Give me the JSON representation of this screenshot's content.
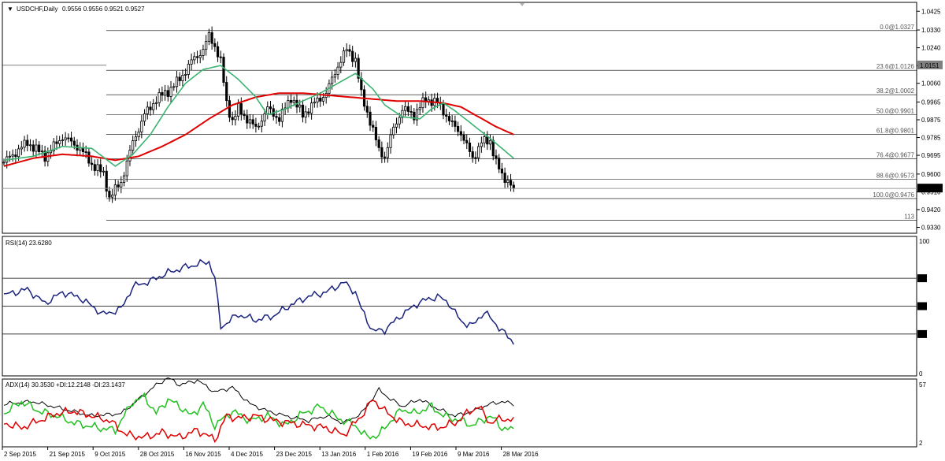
{
  "header": {
    "symbol_title": "USDCHF,Daily",
    "ohlc": "0.9556 0.9556 0.9521 0.9527",
    "dropdown_glyph": "▼"
  },
  "colors": {
    "candle": "#000000",
    "ma_fast": "#3cb371",
    "ma_slow": "#e00000",
    "rsi": "#1a237e",
    "adx": "#000000",
    "plus_di": "#22c020",
    "minus_di": "#e00000",
    "fib": "#000000"
  },
  "chart_data": [
    {
      "type": "candlestick",
      "title": "USDCHF,Daily",
      "ylim": [
        0.93,
        1.047
      ],
      "price_ticks": [
        "1.0425",
        "1.0330",
        "1.0240",
        "1.0150",
        "1.0060",
        "0.9965",
        "0.9875",
        "0.9785",
        "0.9695",
        "0.9600",
        "0.9510",
        "0.9420",
        "0.9330"
      ],
      "price_tick_values": [
        1.0425,
        1.033,
        1.024,
        1.015,
        1.006,
        0.9965,
        0.9875,
        0.9785,
        0.9695,
        0.96,
        0.951,
        0.942,
        0.933
      ],
      "current_price_label": "0.9527",
      "current_price": 0.9527,
      "fib_price_label": "1.0151",
      "fib_price": 1.0151,
      "x_labels": [
        "2 Sep 2015",
        "21 Sep 2015",
        "9 Oct 2015",
        "28 Oct 2015",
        "16 Nov 2015",
        "4 Dec 2015",
        "23 Dec 2015",
        "13 Jan 2016",
        "1 Feb 2016",
        "19 Feb 2016",
        "9 Mar 2016",
        "28 Mar 2016"
      ],
      "fib_levels": [
        {
          "label": "0.0@1.0327",
          "price": 1.0327
        },
        {
          "label": "23.6@1.0126",
          "price": 1.0126
        },
        {
          "label": "38.2@1.0002",
          "price": 1.0002
        },
        {
          "label": "50.0@0.9901",
          "price": 0.9901
        },
        {
          "label": "61.8@0.9801",
          "price": 0.9801
        },
        {
          "label": "76.4@0.9677",
          "price": 0.9677
        },
        {
          "label": "88.6@0.9573",
          "price": 0.9573
        },
        {
          "label": "100.0@0.9476",
          "price": 0.9476
        },
        {
          "label": "113",
          "price": 0.9366
        }
      ],
      "close_keypoints": [
        [
          0,
          0.966
        ],
        [
          8,
          0.976
        ],
        [
          14,
          0.969
        ],
        [
          20,
          0.979
        ],
        [
          26,
          0.973
        ],
        [
          30,
          0.965
        ],
        [
          34,
          0.96
        ],
        [
          36,
          0.948
        ],
        [
          40,
          0.956
        ],
        [
          44,
          0.976
        ],
        [
          48,
          0.99
        ],
        [
          52,
          0.998
        ],
        [
          56,
          1.002
        ],
        [
          60,
          1.008
        ],
        [
          64,
          1.017
        ],
        [
          68,
          1.023
        ],
        [
          70,
          1.03
        ],
        [
          72,
          1.025
        ],
        [
          74,
          1.017
        ],
        [
          76,
          0.996
        ],
        [
          78,
          0.987
        ],
        [
          80,
          0.993
        ],
        [
          83,
          0.988
        ],
        [
          86,
          0.983
        ],
        [
          90,
          0.993
        ],
        [
          94,
          0.988
        ],
        [
          98,
          0.999
        ],
        [
          102,
          0.99
        ],
        [
          106,
          0.996
        ],
        [
          110,
          1.001
        ],
        [
          114,
          1.015
        ],
        [
          117,
          1.023
        ],
        [
          120,
          1.018
        ],
        [
          122,
          1.0
        ],
        [
          125,
          0.987
        ],
        [
          128,
          0.972
        ],
        [
          130,
          0.969
        ],
        [
          133,
          0.983
        ],
        [
          136,
          0.993
        ],
        [
          140,
          0.99
        ],
        [
          144,
          0.998
        ],
        [
          148,
          0.996
        ],
        [
          150,
          0.992
        ],
        [
          153,
          0.985
        ],
        [
          156,
          0.981
        ],
        [
          158,
          0.974
        ],
        [
          160,
          0.968
        ],
        [
          163,
          0.976
        ],
        [
          166,
          0.977
        ],
        [
          168,
          0.966
        ],
        [
          170,
          0.959
        ],
        [
          172,
          0.957
        ],
        [
          174,
          0.9527
        ]
      ],
      "ma_fast_keypoints": [
        [
          0,
          0.967
        ],
        [
          10,
          0.969
        ],
        [
          20,
          0.974
        ],
        [
          30,
          0.973
        ],
        [
          38,
          0.964
        ],
        [
          44,
          0.97
        ],
        [
          50,
          0.98
        ],
        [
          56,
          0.994
        ],
        [
          62,
          1.006
        ],
        [
          68,
          1.013
        ],
        [
          74,
          1.015
        ],
        [
          80,
          1.008
        ],
        [
          86,
          0.999
        ],
        [
          90,
          0.99
        ],
        [
          96,
          0.993
        ],
        [
          102,
          0.997
        ],
        [
          108,
          1.001
        ],
        [
          114,
          1.006
        ],
        [
          120,
          1.011
        ],
        [
          126,
          1.003
        ],
        [
          130,
          0.995
        ],
        [
          136,
          0.989
        ],
        [
          142,
          0.988
        ],
        [
          146,
          0.993
        ],
        [
          150,
          0.996
        ],
        [
          154,
          0.992
        ],
        [
          160,
          0.985
        ],
        [
          166,
          0.978
        ],
        [
          170,
          0.973
        ],
        [
          174,
          0.968
        ]
      ],
      "ma_slow_keypoints": [
        [
          0,
          0.964
        ],
        [
          10,
          0.968
        ],
        [
          20,
          0.97
        ],
        [
          30,
          0.969
        ],
        [
          38,
          0.967
        ],
        [
          46,
          0.969
        ],
        [
          54,
          0.974
        ],
        [
          62,
          0.98
        ],
        [
          70,
          0.988
        ],
        [
          78,
          0.995
        ],
        [
          86,
          0.999
        ],
        [
          94,
          1.001
        ],
        [
          102,
          1.001
        ],
        [
          110,
          1.0
        ],
        [
          118,
          0.999
        ],
        [
          126,
          0.998
        ],
        [
          134,
          0.997
        ],
        [
          142,
          0.997
        ],
        [
          150,
          0.996
        ],
        [
          156,
          0.994
        ],
        [
          162,
          0.989
        ],
        [
          168,
          0.984
        ],
        [
          174,
          0.98
        ]
      ]
    },
    {
      "type": "line",
      "title": "RSI(14) 23.6280",
      "ylim": [
        0,
        100
      ],
      "levels": [
        70,
        50,
        30
      ],
      "y_ticks": [
        "100",
        "70",
        "50",
        "30",
        "0"
      ],
      "y_tick_values": [
        100,
        70,
        50,
        30,
        0
      ],
      "series": [
        {
          "name": "RSI(14)",
          "keypoints": [
            [
              0,
              58
            ],
            [
              8,
              62
            ],
            [
              14,
              52
            ],
            [
              20,
              60
            ],
            [
              26,
              56
            ],
            [
              34,
              44
            ],
            [
              40,
              48
            ],
            [
              44,
              64
            ],
            [
              50,
              68
            ],
            [
              56,
              74
            ],
            [
              62,
              78
            ],
            [
              66,
              80
            ],
            [
              70,
              82
            ],
            [
              72,
              70
            ],
            [
              74,
              35
            ],
            [
              80,
              44
            ],
            [
              86,
              40
            ],
            [
              92,
              43
            ],
            [
              98,
              51
            ],
            [
              104,
              57
            ],
            [
              110,
              60
            ],
            [
              116,
              67
            ],
            [
              120,
              60
            ],
            [
              122,
              48
            ],
            [
              126,
              32
            ],
            [
              130,
              33
            ],
            [
              136,
              44
            ],
            [
              142,
              53
            ],
            [
              148,
              57
            ],
            [
              152,
              52
            ],
            [
              156,
              39
            ],
            [
              160,
              36
            ],
            [
              164,
              46
            ],
            [
              168,
              37
            ],
            [
              172,
              28
            ],
            [
              174,
              24
            ]
          ]
        }
      ]
    },
    {
      "type": "line",
      "title": "ADX(14) 30.3530 +DI:12.2148 -DI:23.1437",
      "ylim": [
        0,
        57
      ],
      "y_ticks": [
        "57",
        "2"
      ],
      "y_tick_values": [
        57,
        2
      ],
      "series": [
        {
          "name": "ADX(14)",
          "keypoints": [
            [
              0,
              36
            ],
            [
              10,
              38
            ],
            [
              20,
              32
            ],
            [
              30,
              26
            ],
            [
              40,
              28
            ],
            [
              46,
              40
            ],
            [
              52,
              52
            ],
            [
              56,
              58
            ],
            [
              60,
              52
            ],
            [
              66,
              56
            ],
            [
              72,
              46
            ],
            [
              78,
              50
            ],
            [
              84,
              36
            ],
            [
              90,
              30
            ],
            [
              96,
              26
            ],
            [
              104,
              22
            ],
            [
              110,
              26
            ],
            [
              116,
              20
            ],
            [
              122,
              28
            ],
            [
              128,
              48
            ],
            [
              132,
              40
            ],
            [
              136,
              34
            ],
            [
              142,
              40
            ],
            [
              148,
              32
            ],
            [
              154,
              26
            ],
            [
              160,
              30
            ],
            [
              166,
              36
            ],
            [
              170,
              38
            ],
            [
              174,
              36
            ]
          ]
        },
        {
          "name": "+DI",
          "keypoints": [
            [
              0,
              28
            ],
            [
              6,
              38
            ],
            [
              12,
              30
            ],
            [
              18,
              26
            ],
            [
              24,
              20
            ],
            [
              32,
              16
            ],
            [
              38,
              14
            ],
            [
              44,
              38
            ],
            [
              48,
              42
            ],
            [
              52,
              28
            ],
            [
              56,
              40
            ],
            [
              60,
              34
            ],
            [
              64,
              26
            ],
            [
              68,
              36
            ],
            [
              72,
              18
            ],
            [
              78,
              30
            ],
            [
              84,
              22
            ],
            [
              90,
              26
            ],
            [
              96,
              18
            ],
            [
              102,
              28
            ],
            [
              108,
              34
            ],
            [
              114,
              24
            ],
            [
              120,
              18
            ],
            [
              124,
              8
            ],
            [
              128,
              10
            ],
            [
              132,
              22
            ],
            [
              136,
              32
            ],
            [
              140,
              28
            ],
            [
              146,
              34
            ],
            [
              150,
              26
            ],
            [
              156,
              22
            ],
            [
              160,
              18
            ],
            [
              166,
              26
            ],
            [
              170,
              16
            ],
            [
              174,
              14
            ]
          ]
        },
        {
          "name": "-DI",
          "keypoints": [
            [
              0,
              20
            ],
            [
              6,
              16
            ],
            [
              12,
              22
            ],
            [
              18,
              28
            ],
            [
              24,
              30
            ],
            [
              30,
              26
            ],
            [
              36,
              22
            ],
            [
              42,
              10
            ],
            [
              48,
              8
            ],
            [
              54,
              12
            ],
            [
              60,
              8
            ],
            [
              66,
              14
            ],
            [
              72,
              6
            ],
            [
              76,
              26
            ],
            [
              80,
              24
            ],
            [
              86,
              26
            ],
            [
              92,
              22
            ],
            [
              98,
              20
            ],
            [
              104,
              18
            ],
            [
              110,
              16
            ],
            [
              116,
              10
            ],
            [
              122,
              26
            ],
            [
              126,
              40
            ],
            [
              130,
              30
            ],
            [
              136,
              20
            ],
            [
              142,
              18
            ],
            [
              148,
              16
            ],
            [
              154,
              20
            ],
            [
              158,
              28
            ],
            [
              162,
              34
            ],
            [
              166,
              20
            ],
            [
              170,
              24
            ],
            [
              174,
              22
            ]
          ]
        }
      ]
    }
  ]
}
